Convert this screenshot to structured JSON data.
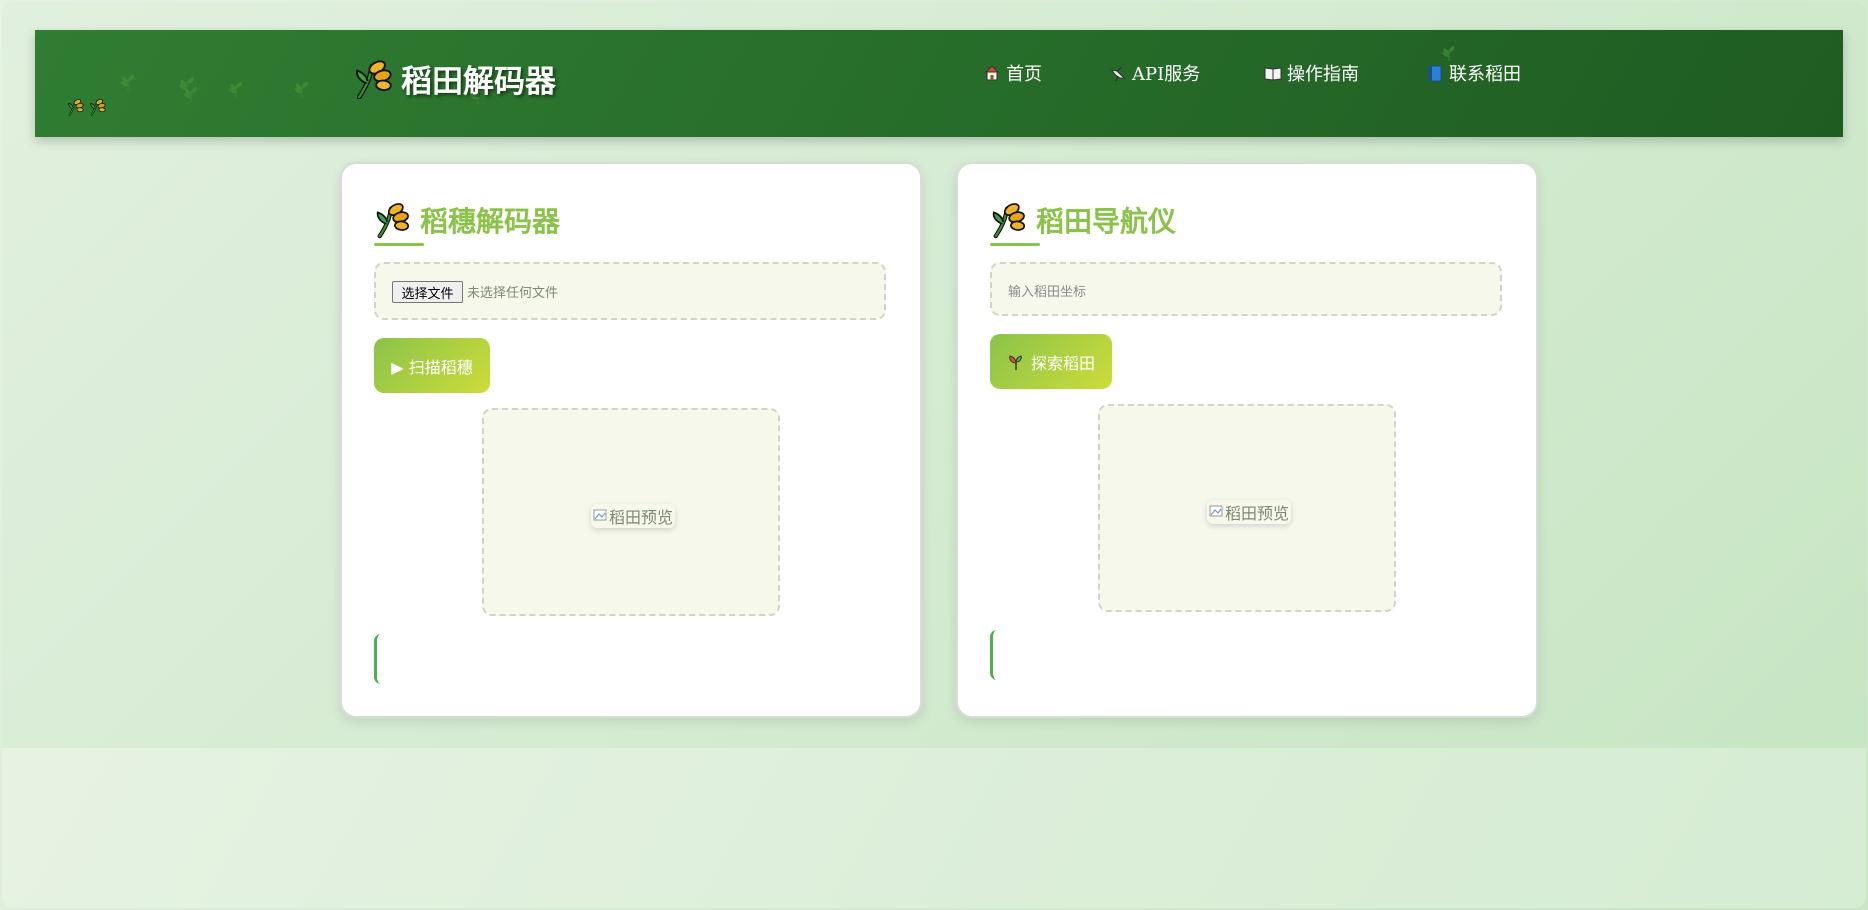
{
  "header": {
    "logo_text": "稻田解码器",
    "nav": [
      {
        "label": "首页",
        "icon": "home-icon"
      },
      {
        "label": "API服务",
        "icon": "satellite-dish-icon"
      },
      {
        "label": "操作指南",
        "icon": "open-book-icon"
      },
      {
        "label": "联系稻田",
        "icon": "blue-book-icon"
      }
    ]
  },
  "cards": [
    {
      "title": "稻穗解码器",
      "file_button": "选择文件",
      "file_status": "未选择任何文件",
      "action_label": "▶ 扫描稻穗",
      "preview_alt": "稻田预览"
    },
    {
      "title": "稻田导航仪",
      "input_placeholder": "输入稻田坐标",
      "action_label": "探索稻田",
      "preview_alt": "稻田预览"
    }
  ],
  "colors": {
    "header_green": "#2e7d32",
    "accent_green": "#8bc34a",
    "accent_lime": "#cddc39",
    "result_border": "#4caf50"
  }
}
